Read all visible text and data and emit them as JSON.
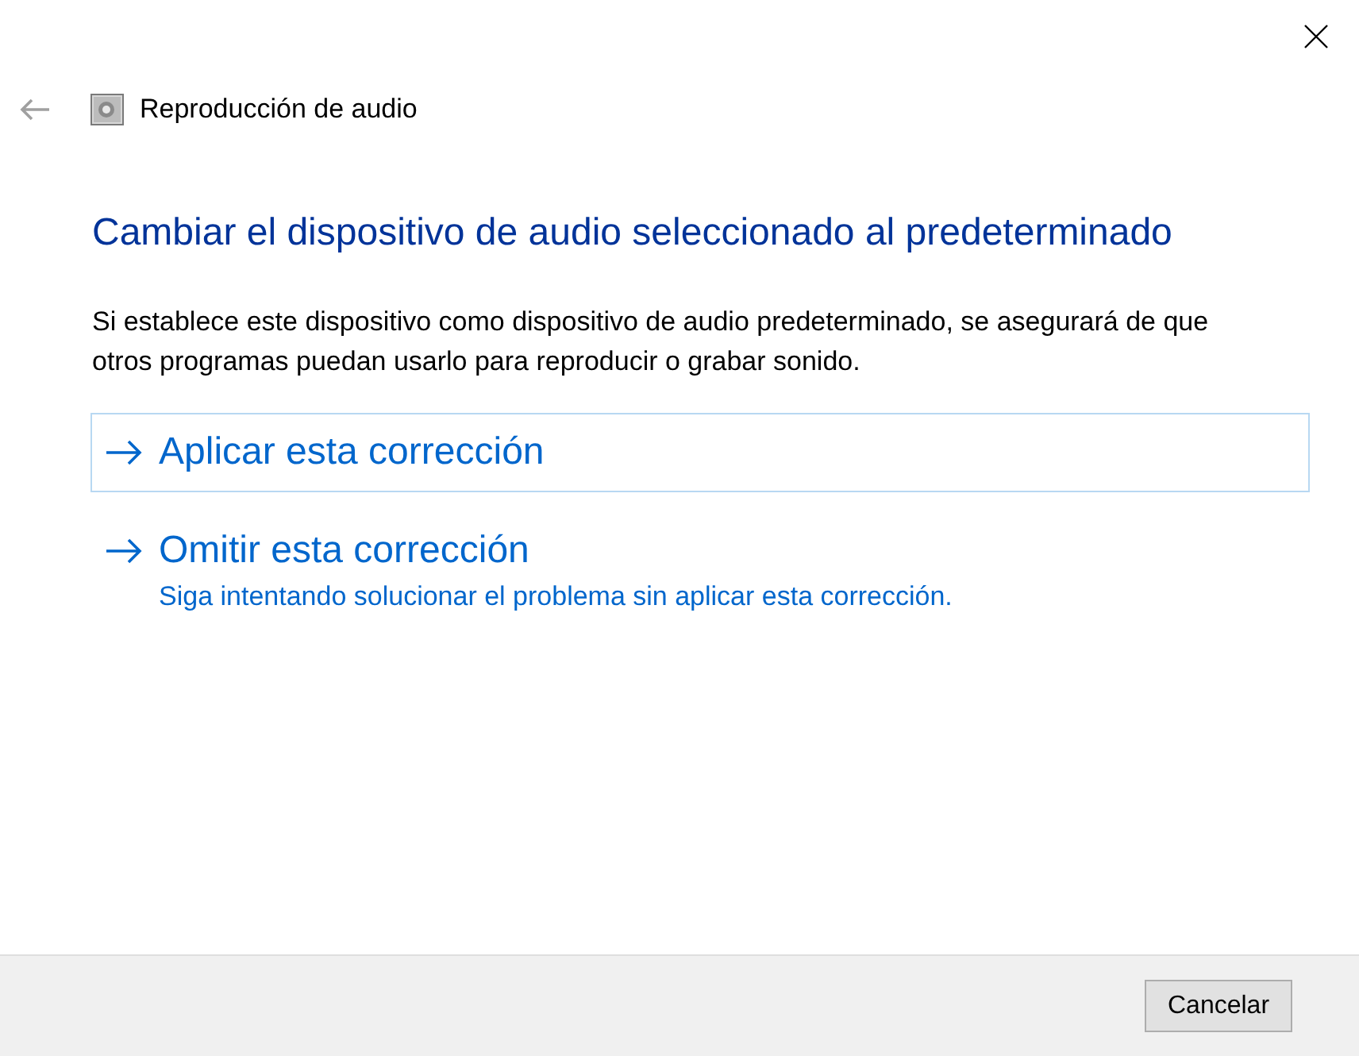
{
  "header": {
    "title": "Reproducción de audio"
  },
  "heading": "Cambiar el dispositivo de audio seleccionado al predeterminado",
  "description": "Si establece este dispositivo como dispositivo de audio predeterminado, se asegurará de que otros programas puedan usarlo para reproducir o grabar sonido.",
  "options": [
    {
      "label": "Aplicar esta corrección",
      "focused": true
    },
    {
      "label": "Omitir esta corrección",
      "description": "Siga intentando solucionar el problema sin aplicar esta corrección.",
      "focused": false
    }
  ],
  "buttons": [
    "Cancelar"
  ]
}
